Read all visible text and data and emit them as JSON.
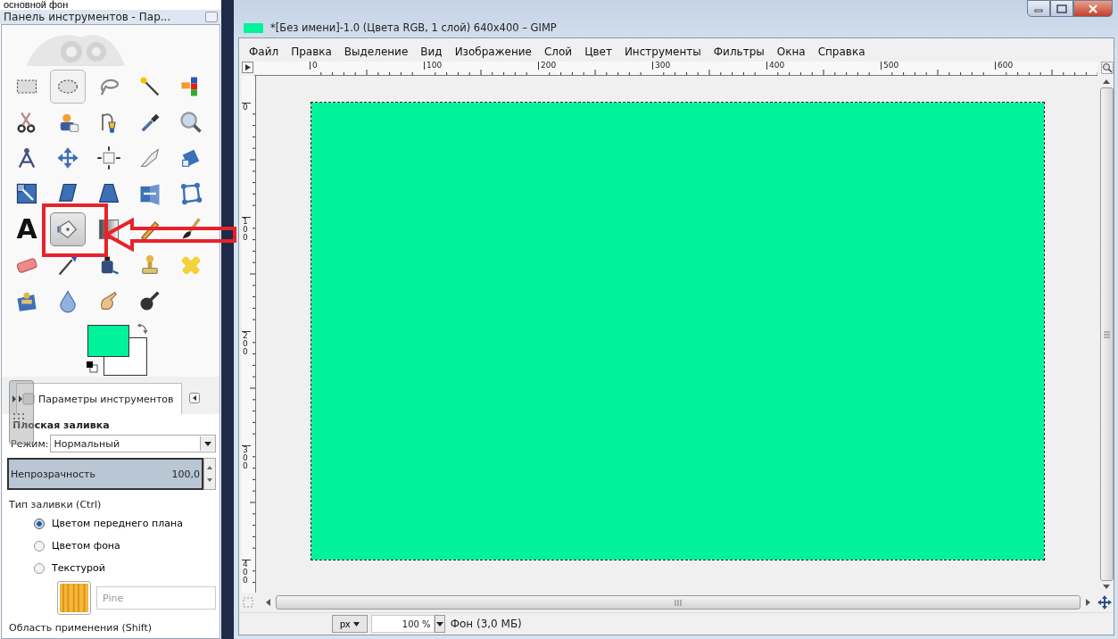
{
  "caption": "основной фон",
  "toolbox": {
    "title": "Панель инструментов - Пар...",
    "tools": [
      {
        "selected": false,
        "hovered": false
      },
      {
        "selected": false,
        "hovered": true
      },
      {
        "selected": false,
        "hovered": false
      },
      {
        "selected": false,
        "hovered": false
      },
      {
        "selected": false,
        "hovered": false
      },
      {
        "selected": false,
        "hovered": false
      },
      {
        "selected": false,
        "hovered": false
      },
      {
        "selected": false,
        "hovered": false
      },
      {
        "selected": false,
        "hovered": false
      },
      {
        "selected": false,
        "hovered": false
      },
      {
        "selected": false,
        "hovered": false
      },
      {
        "selected": false,
        "hovered": false
      },
      {
        "selected": false,
        "hovered": false
      },
      {
        "selected": false,
        "hovered": false
      },
      {
        "selected": false,
        "hovered": false
      },
      {
        "selected": false,
        "hovered": false
      },
      {
        "selected": false,
        "hovered": false
      },
      {
        "selected": false,
        "hovered": false
      },
      {
        "selected": false,
        "hovered": false
      },
      {
        "selected": false,
        "hovered": false
      },
      {
        "glyph": "A",
        "selected": false,
        "hovered": false
      },
      {
        "selected": true,
        "hovered": false
      },
      {
        "selected": false,
        "hovered": false
      },
      {
        "selected": false,
        "hovered": false
      },
      {
        "selected": false,
        "hovered": false
      },
      {
        "selected": false,
        "hovered": false
      },
      {
        "selected": false,
        "hovered": false
      },
      {
        "selected": false,
        "hovered": false
      },
      {
        "selected": false,
        "hovered": false
      },
      {
        "selected": false,
        "hovered": false
      },
      {
        "selected": false,
        "hovered": false
      },
      {
        "selected": false,
        "hovered": false
      },
      {
        "selected": false,
        "hovered": false
      },
      {
        "selected": false,
        "hovered": false
      }
    ]
  },
  "tool_options": {
    "tab": "Параметры инструментов",
    "heading": "Плоская заливка",
    "mode_label": "Режим:",
    "mode": "Нормальный",
    "opacity": {
      "label": "Непрозрачность",
      "value": "100,0",
      "level": 1
    },
    "fill_type_label": "Тип заливки (Ctrl)",
    "fill_types": [
      {
        "label": "Цветом переднего плана",
        "selected": true
      },
      {
        "label": "Цветом фона",
        "selected": false
      },
      {
        "label": "Текстурой",
        "selected": false
      }
    ],
    "pattern": "Pine",
    "area_label": "Область применения (Shift)"
  },
  "image_window": {
    "title": "*[Без имени]-1.0 (Цвета RGB, 1 слой) 640x400 – GIMP",
    "menu": [
      "Файл",
      "Правка",
      "Выделение",
      "Вид",
      "Изображение",
      "Слой",
      "Цвет",
      "Инструменты",
      "Фильтры",
      "Окна",
      "Справка"
    ],
    "ruler_h": [
      "0",
      "100",
      "200",
      "300",
      "400",
      "500",
      "600"
    ],
    "ruler_v": [
      "0",
      "100",
      "200",
      "300",
      "400"
    ],
    "status": {
      "unit": "px",
      "zoom": "100 %",
      "layer": "Фон (3,0 МБ)"
    }
  }
}
